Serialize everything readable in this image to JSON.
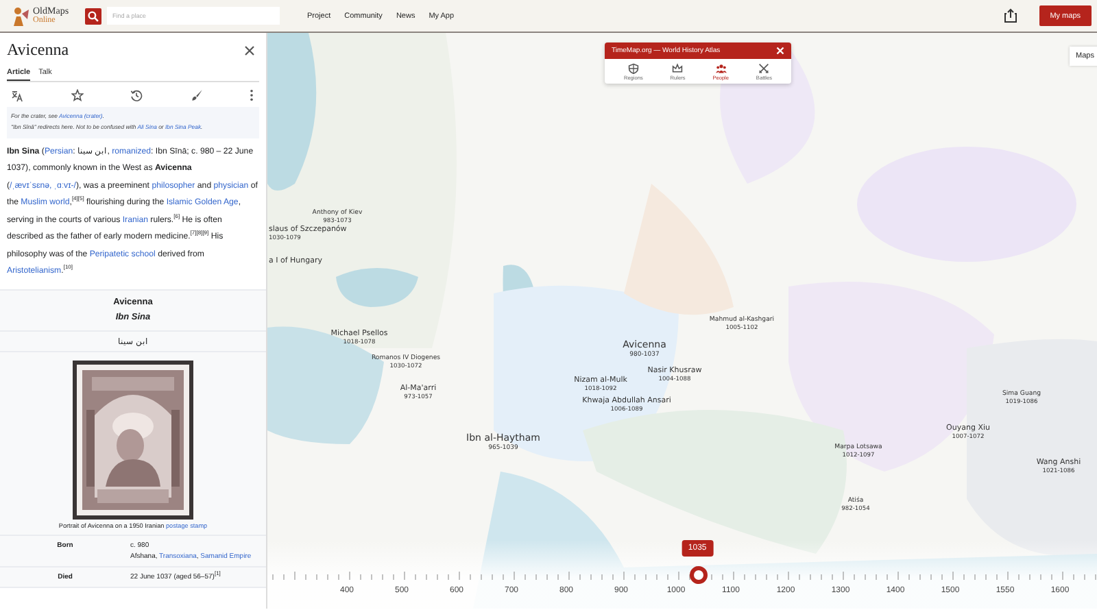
{
  "header": {
    "logo": {
      "top": "OldMaps",
      "bottom": "Online"
    },
    "search": {
      "placeholder": "Find a place"
    },
    "nav": [
      "Project",
      "Community",
      "News",
      "My App"
    ],
    "my_maps": "My maps"
  },
  "article": {
    "title": "Avicenna",
    "tabs": [
      {
        "label": "Article",
        "selected": true
      },
      {
        "label": "Talk",
        "selected": false
      }
    ],
    "hatnotes": [
      [
        {
          "t": "For the crater, see "
        },
        {
          "t": "Avicenna (crater)",
          "link": true
        },
        {
          "t": "."
        }
      ],
      [
        {
          "t": "\"Ibn Sīnā\" redirects here. Not to be confused with "
        },
        {
          "t": "Ali Sina",
          "link": true
        },
        {
          "t": " or "
        },
        {
          "t": "Ibn Sina Peak",
          "link": true
        },
        {
          "t": "."
        }
      ]
    ],
    "lead": [
      {
        "t": "**Ibn Sina** ("
      },
      {
        "t": "Persian",
        "link": true
      },
      {
        "t": ": ابن سینا, "
      },
      {
        "t": "romanized",
        "link": true
      },
      {
        "t": ": Ibn Sīnā; c. 980 – 22 June 1037), commonly known in the West as **Avicenna** ("
      },
      {
        "t": "/ˌævɪˈsɛnə, ˌɑːvɪ-/",
        "link": true
      },
      {
        "t": "), was a preeminent "
      },
      {
        "t": "philosopher",
        "link": true
      },
      {
        "t": " and "
      },
      {
        "t": "physician",
        "link": true
      },
      {
        "t": " of the "
      },
      {
        "t": "Muslim world",
        "link": true
      },
      {
        "t": ",$^{[4][5]}$ flourishing during the "
      },
      {
        "t": "Islamic Golden Age",
        "link": true
      },
      {
        "t": ", serving in the courts of various "
      },
      {
        "t": "Iranian",
        "link": true
      },
      {
        "t": " rulers.$^{[6]}$ He is often described as the father of early modern medicine.$^{[7][8][9]}$ His philosophy was of the "
      },
      {
        "t": "Peripatetic school",
        "link": true
      },
      {
        "t": " derived from "
      },
      {
        "t": "Aristotelianism",
        "link": true
      },
      {
        "t": ".$^{[10]}$"
      }
    ],
    "infobox": {
      "name": "Avicenna",
      "native": "Ibn Sina",
      "script": "ابن سینا",
      "caption": [
        {
          "t": "Portrait of Avicenna on a 1950 Iranian "
        },
        {
          "t": "postage stamp",
          "link": true
        }
      ],
      "rows": [
        {
          "label": "Born",
          "lines": [
            [
              {
                "t": "c. 980"
              }
            ],
            [
              {
                "t": "Afshana, "
              },
              {
                "t": "Transoxiana",
                "link": true
              },
              {
                "t": ", "
              },
              {
                "t": "Samanid Empire",
                "link": true
              }
            ]
          ]
        },
        {
          "label": "Died",
          "lines": [
            [
              {
                "t": "22 June 1037 (aged 56–57)$^{[1]}$"
              }
            ]
          ]
        }
      ]
    }
  },
  "atlas": {
    "title": "TimeMap.org — World History Atlas",
    "layers": [
      {
        "label": "Regions",
        "kind": "regions",
        "selected": false
      },
      {
        "label": "Rulers",
        "kind": "rulers",
        "selected": false
      },
      {
        "label": "People",
        "kind": "people",
        "selected": true
      },
      {
        "label": "Battles",
        "kind": "battles",
        "selected": false
      }
    ]
  },
  "maps_button": "Maps",
  "people": [
    {
      "name": "Avicenna",
      "dates": "980-1037",
      "kind": "major"
    },
    {
      "name": "Nasir Khusraw",
      "dates": "1004-1088",
      "kind": "mid"
    },
    {
      "name": "Nizam al-Mulk",
      "dates": "1018-1092",
      "kind": "mid"
    },
    {
      "name": "Khwaja Abdullah Ansari",
      "dates": "1006-1089",
      "kind": "mid"
    },
    {
      "name": "Ibn al-Haytham",
      "dates": "965-1039",
      "kind": "major"
    },
    {
      "name": "Al-Ma'arri",
      "dates": "973-1057",
      "kind": "mid"
    },
    {
      "name": "Michael Psellos",
      "dates": "1018-1078",
      "kind": "mid"
    },
    {
      "name": "Romanos IV Diogenes",
      "dates": "1030-1072",
      "kind": "minor"
    },
    {
      "name": "Ouyang Xiu",
      "dates": "1007-1072",
      "kind": "mid"
    },
    {
      "name": "Wang Anshi",
      "dates": "1021-1086",
      "kind": "mid"
    },
    {
      "name": "Sima Guang",
      "dates": "1019-1086",
      "kind": "minor"
    },
    {
      "name": "Marpa Lotsawa",
      "dates": "1012-1097",
      "kind": "minor"
    },
    {
      "name": "Mahmud al-Kashgari",
      "dates": "1005-1102",
      "kind": "minor"
    },
    {
      "name": "Atiśa",
      "dates": "982-1054",
      "kind": "minor"
    },
    {
      "name": "Anthony of Kiev",
      "dates": "983-1073",
      "kind": "minor"
    },
    {
      "name": "slaus of Szczepanów",
      "dates": "1030-1079",
      "kind": "mid"
    },
    {
      "name": "a I of Hungary",
      "kind": "mid"
    }
  ],
  "timeline": {
    "year": "1035",
    "level": 0.52,
    "ticks": [
      "400",
      "500",
      "600",
      "700",
      "800",
      "900",
      "1000",
      "1100",
      "1200",
      "1300",
      "1400",
      "1500",
      "1550",
      "1600"
    ]
  }
}
